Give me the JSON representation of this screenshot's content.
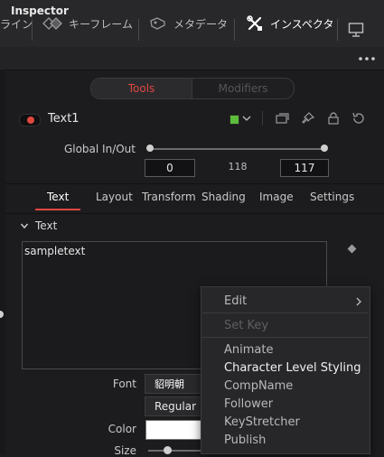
{
  "toolbar": {
    "items": [
      {
        "label": "ライン"
      },
      {
        "label": "キーフレーム"
      },
      {
        "label": "メタデータ"
      },
      {
        "label": "インスペクタ"
      }
    ]
  },
  "inspector": {
    "title": "Inspector",
    "tabs_top": {
      "tools": "Tools",
      "modifiers": "Modifiers"
    },
    "node": {
      "name": "Text1",
      "color": "#5bbd3a"
    },
    "global_inout": {
      "label": "Global In/Out",
      "in": "0",
      "mid": "118",
      "out": "117"
    },
    "tabs": [
      "Text",
      "Layout",
      "Transform",
      "Shading",
      "Image",
      "Settings"
    ],
    "active_tab": "Text",
    "section": "Text",
    "styled_text": "sampletext",
    "font": {
      "label": "Font",
      "family": "貂明朝",
      "style": "Regular"
    },
    "color": {
      "label": "Color",
      "value": "#ffffff"
    },
    "size": {
      "label": "Size"
    }
  },
  "context_menu": {
    "items": [
      {
        "label": "Edit",
        "state": "normal",
        "submenu": true
      },
      {
        "label": "Set Key",
        "state": "disabled"
      },
      {
        "label": "Animate",
        "state": "normal"
      },
      {
        "label": "Character Level Styling",
        "state": "highlight"
      },
      {
        "label": "CompName",
        "state": "normal"
      },
      {
        "label": "Follower",
        "state": "normal"
      },
      {
        "label": "KeyStretcher",
        "state": "normal"
      },
      {
        "label": "Publish",
        "state": "normal"
      }
    ]
  },
  "colors": {
    "accent": "#e0473f",
    "active_node": "#5bbd3a"
  }
}
